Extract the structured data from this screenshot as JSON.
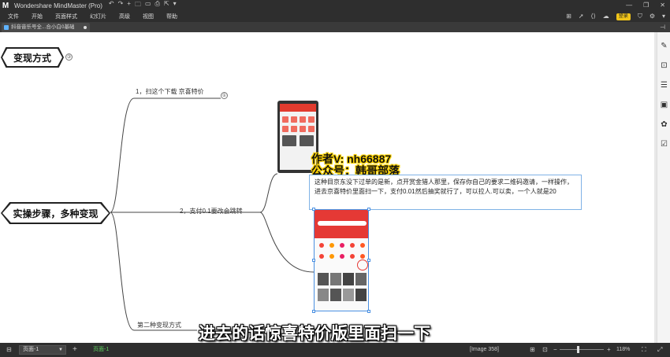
{
  "app": {
    "logo_text": "M",
    "title": "Wondershare MindMaster (Pro)",
    "quick_access": [
      "↶",
      "↷",
      "+",
      "🗀",
      "▭",
      "⎙",
      "⇱",
      "▾"
    ],
    "window_controls": [
      "—",
      "❐",
      "✕"
    ]
  },
  "menu": {
    "items": [
      "文件",
      "开始",
      "页面样式",
      "幻灯片",
      "高级",
      "视图",
      "帮助"
    ],
    "login_label": "登录",
    "tool_icons": [
      "⊞",
      "➚",
      "⟨⟩",
      "☁"
    ],
    "extra_icons": [
      "⛉",
      "⚙",
      "▾"
    ]
  },
  "tab": {
    "label": "抖音音乐号全...合小白0基础",
    "pin": "⊣"
  },
  "canvas": {
    "top_topic": "变现方式",
    "top_topic_num": "③",
    "main_topic": "实操步骤，多种变现",
    "branch1": "1，扫这个下载 京喜特价",
    "branch1_num": "①",
    "branch2": "2，支付0.1要改会跳转",
    "branch3": "第二种变现方式",
    "watermark_line1": "作者V:   nh66887",
    "watermark_line2": "公众号：韩哥部落",
    "note_text": "这种目京东没下过单的是新，点开赏金猎人那里，保存你自己的要求二维码邀请，一样操作，进去京喜特价里面扫一下，支付0.01然后抽奖就行了，可以拉人.可以卖，一个人就是20",
    "subtitle": "进去的话惊喜特价版里面扫一下"
  },
  "status": {
    "page_select": "页面-1",
    "page_tab": "页面-1",
    "add_page": "+",
    "image_info": "[Image 358]",
    "zoom": "118%"
  }
}
